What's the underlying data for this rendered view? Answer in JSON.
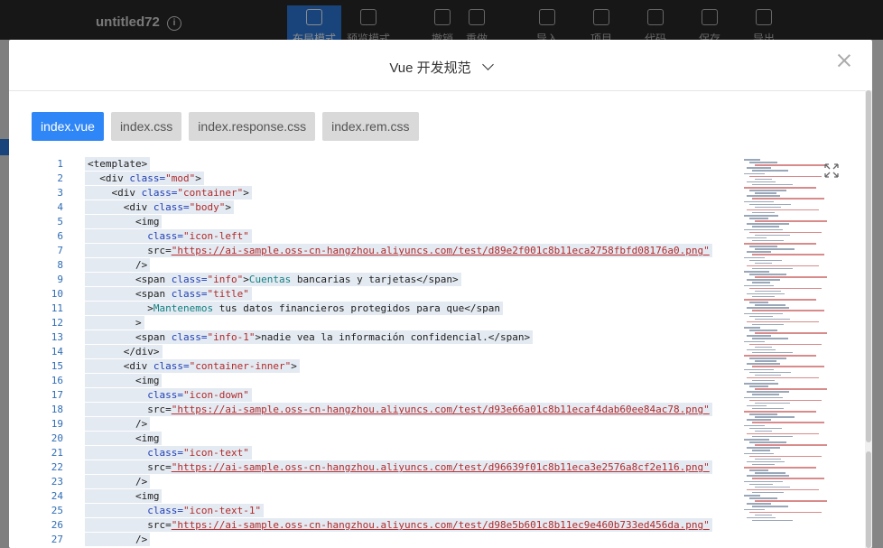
{
  "app": {
    "doc_title": "untitled72",
    "info_icon": "info-icon",
    "toolbar": [
      {
        "label": "布局模式",
        "icon": "layout-mode-icon",
        "active": true
      },
      {
        "label": "预览模式",
        "icon": "preview-mode-icon",
        "active": false
      },
      {
        "label": "撤销",
        "icon": "undo-icon",
        "active": false
      },
      {
        "label": "重做",
        "icon": "redo-icon",
        "active": false
      },
      {
        "label": "导入",
        "icon": "diamond-icon",
        "active": false
      },
      {
        "label": "项目",
        "icon": "project-icon",
        "active": false
      },
      {
        "label": "代码",
        "icon": "code-icon",
        "active": false
      },
      {
        "label": "保存",
        "icon": "check-circle-icon",
        "active": false
      },
      {
        "label": "导出",
        "icon": "export-icon",
        "active": false
      }
    ]
  },
  "modal": {
    "title": "Vue 开发规范",
    "tabs": [
      {
        "label": "index.vue",
        "active": true
      },
      {
        "label": "index.css",
        "active": false
      },
      {
        "label": "index.response.css",
        "active": false
      },
      {
        "label": "index.rem.css",
        "active": false
      }
    ],
    "colors": {
      "accent": "#2f86f6",
      "tab_inactive": "#d9d9d9",
      "line_number": "#2f6db5",
      "attr": "#1f3fb5",
      "string": "#b02a2a"
    },
    "code_lines": [
      {
        "n": "1",
        "html": "<span class=\"t-tag\">&lt;template&gt;</span>"
      },
      {
        "n": "2",
        "html": "  <span class=\"t-tag\">&lt;div </span><span class=\"t-attr\">class=</span><span class=\"t-str\">\"mod\"</span><span class=\"t-tag\">&gt;</span>"
      },
      {
        "n": "3",
        "html": "    <span class=\"t-tag\">&lt;div </span><span class=\"t-attr\">class=</span><span class=\"t-str\">\"container\"</span><span class=\"t-tag\">&gt;</span>"
      },
      {
        "n": "4",
        "html": "      <span class=\"t-tag\">&lt;div </span><span class=\"t-attr\">class=</span><span class=\"t-str\">\"body\"</span><span class=\"t-tag\">&gt;</span>"
      },
      {
        "n": "5",
        "html": "        <span class=\"t-tag\">&lt;img</span>"
      },
      {
        "n": "6",
        "html": "          <span class=\"t-attr\">class=</span><span class=\"t-str\">\"icon-left\"</span>"
      },
      {
        "n": "7",
        "html": "          <span class=\"t-tag\">src=</span><span class=\"t-url\">\"https://ai-sample.oss-cn-hangzhou.aliyuncs.com/test/d89e2f001c8b11eca2758fbfd08176a0.png\"</span>"
      },
      {
        "n": "8",
        "html": "        <span class=\"t-tag\">/&gt;</span>"
      },
      {
        "n": "9",
        "html": "        <span class=\"t-tag\">&lt;span </span><span class=\"t-attr\">class=</span><span class=\"t-str\">\"info\"</span><span class=\"t-tag\">&gt;</span><span class=\"t-kw\">Cuentas</span><span class=\"t-txt\"> bancarias y tarjetas</span><span class=\"t-tag\">&lt;/span&gt;</span>"
      },
      {
        "n": "10",
        "html": "        <span class=\"t-tag\">&lt;span </span><span class=\"t-attr\">class=</span><span class=\"t-str\">\"title\"</span>"
      },
      {
        "n": "11",
        "html": "          <span class=\"t-tag\">&gt;</span><span class=\"t-kw\">Mantenemos</span><span class=\"t-txt\"> tus datos financieros protegidos para que</span><span class=\"t-tag\">&lt;/span</span>"
      },
      {
        "n": "12",
        "html": "        <span class=\"t-tag\">&gt;</span>"
      },
      {
        "n": "13",
        "html": "        <span class=\"t-tag\">&lt;span </span><span class=\"t-attr\">class=</span><span class=\"t-str\">\"info-1\"</span><span class=\"t-tag\">&gt;</span><span class=\"t-txt\">nadie vea la información confidencial.</span><span class=\"t-tag\">&lt;/span&gt;</span>"
      },
      {
        "n": "14",
        "html": "      <span class=\"t-tag\">&lt;/div&gt;</span>"
      },
      {
        "n": "15",
        "html": "      <span class=\"t-tag\">&lt;div </span><span class=\"t-attr\">class=</span><span class=\"t-str\">\"container-inner\"</span><span class=\"t-tag\">&gt;</span>"
      },
      {
        "n": "16",
        "html": "        <span class=\"t-tag\">&lt;img</span>"
      },
      {
        "n": "17",
        "html": "          <span class=\"t-attr\">class=</span><span class=\"t-str\">\"icon-down\"</span>"
      },
      {
        "n": "18",
        "html": "          <span class=\"t-tag\">src=</span><span class=\"t-url\">\"https://ai-sample.oss-cn-hangzhou.aliyuncs.com/test/d93e66a01c8b11ecaf4dab60ee84ac78.png\"</span>"
      },
      {
        "n": "19",
        "html": "        <span class=\"t-tag\">/&gt;</span>"
      },
      {
        "n": "20",
        "html": "        <span class=\"t-tag\">&lt;img</span>"
      },
      {
        "n": "21",
        "html": "          <span class=\"t-attr\">class=</span><span class=\"t-str\">\"icon-text\"</span>"
      },
      {
        "n": "22",
        "html": "          <span class=\"t-tag\">src=</span><span class=\"t-url\">\"https://ai-sample.oss-cn-hangzhou.aliyuncs.com/test/d96639f01c8b11eca3e2576a8cf2e116.png\"</span>"
      },
      {
        "n": "23",
        "html": "        <span class=\"t-tag\">/&gt;</span>"
      },
      {
        "n": "24",
        "html": "        <span class=\"t-tag\">&lt;img</span>"
      },
      {
        "n": "25",
        "html": "          <span class=\"t-attr\">class=</span><span class=\"t-str\">\"icon-text-1\"</span>"
      },
      {
        "n": "26",
        "html": "          <span class=\"t-tag\">src=</span><span class=\"t-url\">\"https://ai-sample.oss-cn-hangzhou.aliyuncs.com/test/d98e5b601c8b11ec9e460b733ed456da.png\"</span>"
      },
      {
        "n": "27",
        "html": "        <span class=\"t-tag\">/&gt;</span>"
      }
    ]
  }
}
